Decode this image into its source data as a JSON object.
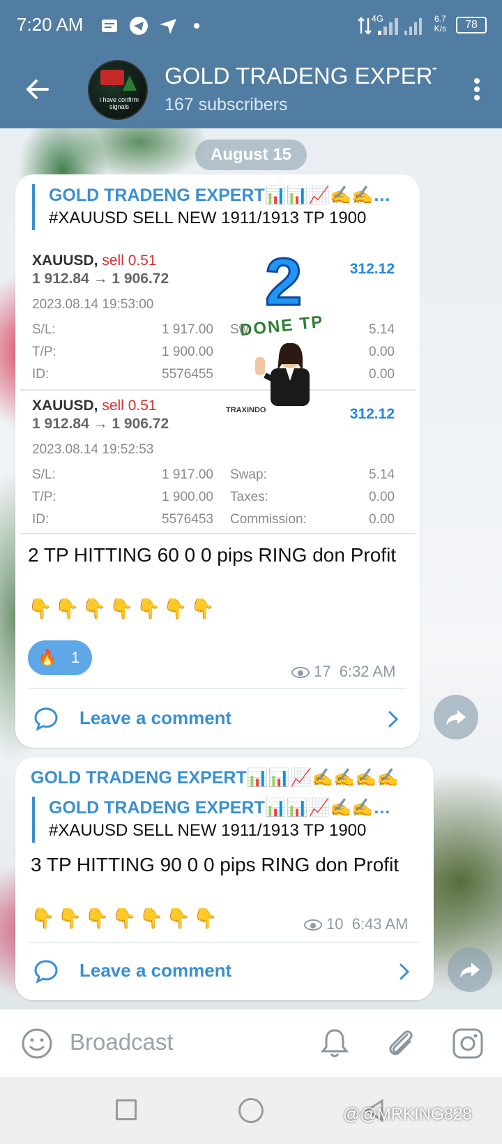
{
  "status_bar": {
    "time": "7:20 AM",
    "network": "4G",
    "speed_value": "6.7",
    "speed_unit": "K/s",
    "battery": "78"
  },
  "header": {
    "channel_name": "GOLD TRADENG EXPERT",
    "subscribers": "167 subscribers",
    "avatar_caption": "i have confirm signals"
  },
  "date_separator": "August 15",
  "message1": {
    "forward_from": "GOLD TRADENG EXPERT📊📊📈✍️✍️✍️✍️",
    "forward_text": "#XAUUSD SELL NEW 1911/1913  TP 1900",
    "trades": [
      {
        "symbol": "XAUUSD,",
        "side": "sell 0.51",
        "price": "1 912.84 → 1 906.72",
        "profit": "312.12",
        "date": "2023.08.14 19:53:00",
        "sl_label": "S/L:",
        "sl": "1 917.00",
        "swap_label": "Sw",
        "swap": "5.14",
        "tp_label": "T/P:",
        "tp": "1 900.00",
        "taxes_label": "",
        "taxes": "0.00",
        "id_label": "ID:",
        "id": "5576455",
        "comm_label": "",
        "comm": "0.00"
      },
      {
        "symbol": "XAUUSD,",
        "side": "sell 0.51",
        "price": "1 912.84 → 1 906.72",
        "profit": "312.12",
        "date": "2023.08.14 19:52:53",
        "sl_label": "S/L:",
        "sl": "1 917.00",
        "swap_label": "Swap:",
        "swap": "5.14",
        "tp_label": "T/P:",
        "tp": "1 900.00",
        "taxes_label": "Taxes:",
        "taxes": "0.00",
        "id_label": "ID:",
        "id": "5576453",
        "comm_label": "Commission:",
        "comm": "0.00"
      }
    ],
    "sticker": {
      "number": "2",
      "label": "DONE TP",
      "brand": "TRAXINDO"
    },
    "text": "2 TP HITTING 60 0 0 pips RING don Profit",
    "hands": "👇👇👇👇👇👇👇",
    "reaction_emoji": "🔥",
    "reaction_count": "1",
    "views": "17",
    "time": "6:32 AM",
    "comment_label": "Leave a comment"
  },
  "message2": {
    "sender": "GOLD TRADENG EXPERT📊📊📈✍️✍️✍️✍️",
    "forward_from": "GOLD TRADENG EXPERT📊📊📈✍️✍️✍️✍️",
    "forward_text": "#XAUUSD SELL NEW 1911/1913  TP 1900",
    "text": "3 TP HITTING 90 0 0 pips RING don Profit",
    "hands": "👇👇👇👇👇👇👇",
    "views": "10",
    "time": "6:43 AM",
    "comment_label": "Leave a comment"
  },
  "input": {
    "placeholder": "Broadcast"
  },
  "watermark": "@@MRKING828",
  "colors": {
    "header": "#517da2",
    "accent": "#3a8fd2",
    "profit": "#1e88e5",
    "sell": "#d32f2f"
  }
}
